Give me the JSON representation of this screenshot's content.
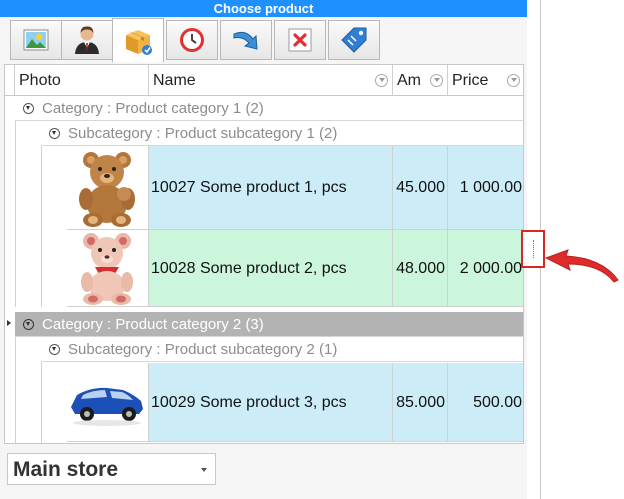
{
  "window": {
    "title": "Choose product"
  },
  "tabs": [
    {
      "icon": "image-icon",
      "active": false
    },
    {
      "icon": "user-icon",
      "active": false
    },
    {
      "icon": "product-box-icon",
      "active": true
    },
    {
      "icon": "clock-icon",
      "active": false
    },
    {
      "icon": "redo-arrow-icon",
      "active": false
    },
    {
      "icon": "delete-icon",
      "active": false
    },
    {
      "icon": "price-tag-icon",
      "active": false
    }
  ],
  "grid": {
    "columns": [
      {
        "label": "Photo"
      },
      {
        "label": "Name"
      },
      {
        "label": "Am"
      },
      {
        "label": "Price"
      }
    ],
    "groups": [
      {
        "label": "Category : Product category 1 (2)",
        "subgroups": [
          {
            "label": "Subcategory : Product subcategory 1 (2)",
            "rows": [
              {
                "photo": "teddy-bear-brown",
                "name": "10027 Some product 1, pcs",
                "amount": "45.000",
                "price": "1 000.00"
              },
              {
                "photo": "teddy-bear-pink",
                "name": "10028 Some product 2, pcs",
                "amount": "48.000",
                "price": "2 000.00"
              }
            ]
          }
        ]
      },
      {
        "label": "Category : Product category 2 (3)",
        "subgroups": [
          {
            "label": "Subcategory : Product subcategory 2 (1)",
            "rows": [
              {
                "photo": "toy-car-blue",
                "name": "10029 Some product 3, pcs",
                "amount": "85.000",
                "price": "500.00"
              }
            ]
          }
        ]
      }
    ]
  },
  "store": {
    "value": "Main store"
  },
  "colors": {
    "titlebar": "#1e90ff",
    "row_blue": "#ccecf8",
    "row_green": "#ccf6dc",
    "selected_group": "#b3b3b3",
    "highlight": "#d92626"
  }
}
